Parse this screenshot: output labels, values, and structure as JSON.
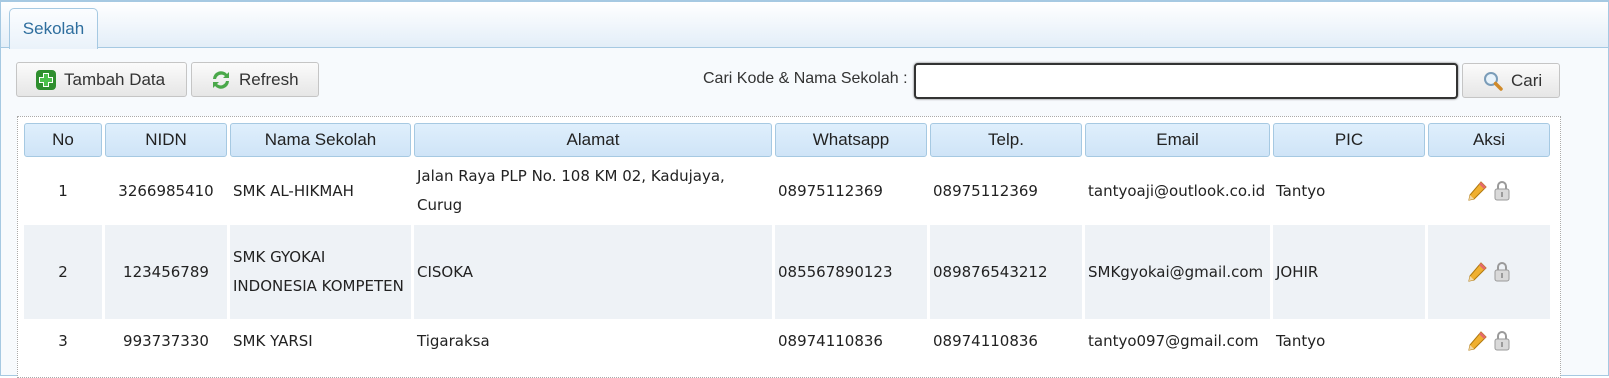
{
  "tab": {
    "label": "Sekolah"
  },
  "toolbar": {
    "add_label": "Tambah Data",
    "refresh_label": "Refresh",
    "search_label": "Cari Kode & Nama Sekolah :",
    "search_value": "",
    "search_button_label": "Cari"
  },
  "table": {
    "headers": {
      "no": "No",
      "nidn": "NIDN",
      "nama": "Nama Sekolah",
      "alamat": "Alamat",
      "whatsapp": "Whatsapp",
      "telp": "Telp.",
      "email": "Email",
      "pic": "PIC",
      "aksi": "Aksi"
    },
    "rows": [
      {
        "no": "1",
        "nidn": "3266985410",
        "nama": "SMK AL-HIKMAH",
        "alamat": "Jalan Raya PLP No. 108 KM 02, Kadujaya, Curug",
        "whatsapp": "08975112369",
        "telp": "08975112369",
        "email": "tantyoaji@outlook.co.id",
        "pic": "Tantyo"
      },
      {
        "no": "2",
        "nidn": "123456789",
        "nama": "SMK GYOKAI INDONESIA KOMPETEN",
        "alamat": "CISOKA",
        "whatsapp": "085567890123",
        "telp": "089876543212",
        "email": "SMKgyokai@gmail.com",
        "pic": "JOHIR"
      },
      {
        "no": "3",
        "nidn": "993737330",
        "nama": "SMK YARSI",
        "alamat": "Tigaraksa",
        "whatsapp": "08974110836",
        "telp": "08974110836",
        "email": "tantyo097@gmail.com",
        "pic": "Tantyo"
      }
    ]
  },
  "icons": {
    "add": "plus-icon",
    "refresh": "refresh-icon",
    "search": "magnifier-icon",
    "edit": "pencil-icon",
    "delete": "lock-icon"
  },
  "colors": {
    "accent": "#2e6e9e",
    "header_bg": "#dfeffc",
    "border": "#a6c9e2",
    "add_green": "#3aa13a"
  }
}
